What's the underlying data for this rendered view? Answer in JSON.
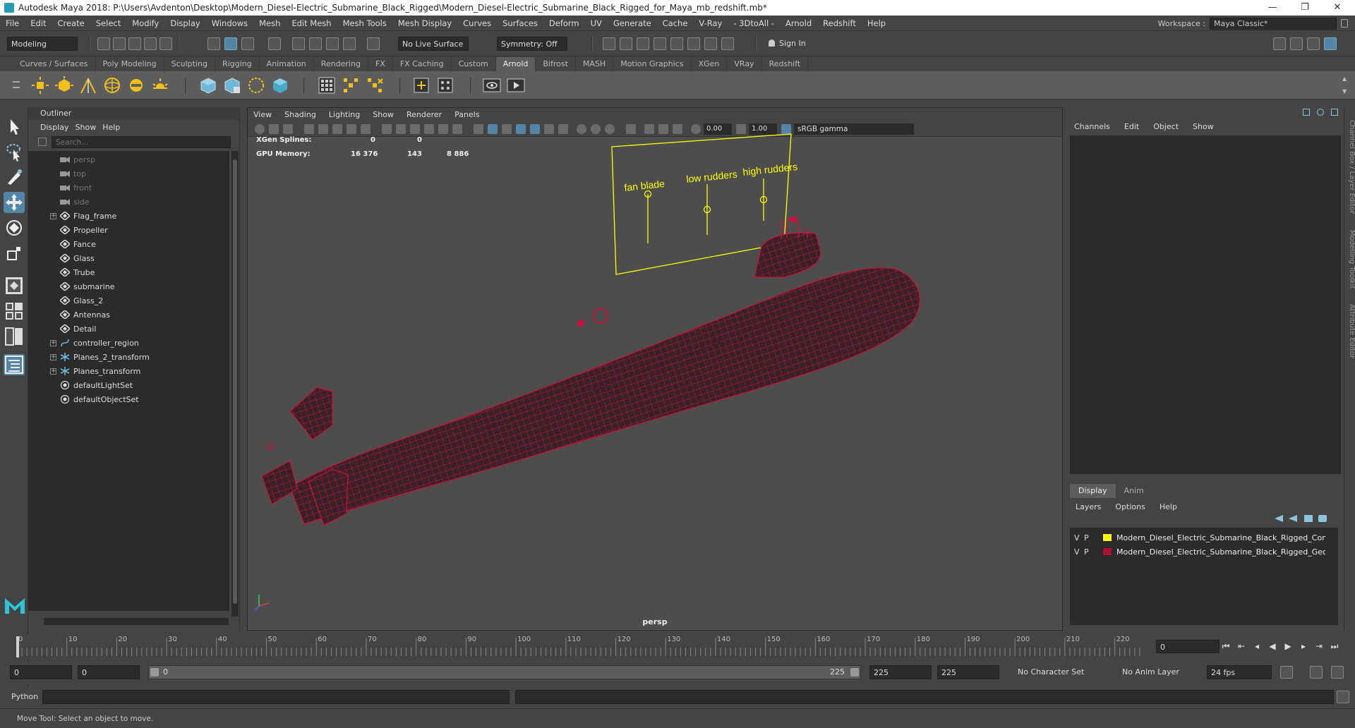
{
  "window": {
    "title": "Autodesk Maya 2018: P:\\Users\\Avdenton\\Desktop\\Modern_Diesel-Electric_Submarine_Black_Rigged\\Modern_Diesel-Electric_Submarine_Black_Rigged_for_Maya_mb_redshift.mb*",
    "minimize": "—",
    "maximize": "❐",
    "close": "✕"
  },
  "menubar": [
    "File",
    "Edit",
    "Create",
    "Select",
    "Modify",
    "Display",
    "Windows",
    "Mesh",
    "Edit Mesh",
    "Mesh Tools",
    "Mesh Display",
    "Curves",
    "Surfaces",
    "Deform",
    "UV",
    "Generate",
    "Cache",
    "V-Ray",
    "- 3DtoAll -",
    "Arnold",
    "Redshift",
    "Help"
  ],
  "workspace": {
    "label": "Workspace :",
    "value": "Maya Classic*"
  },
  "statusline": {
    "mode": "Modeling",
    "live_surface": "No Live Surface",
    "symmetry": "Symmetry: Off",
    "sign_in": "Sign In"
  },
  "shelf_tabs": [
    "Curves / Surfaces",
    "Poly Modeling",
    "Sculpting",
    "Rigging",
    "Animation",
    "Rendering",
    "FX",
    "FX Caching",
    "Custom",
    "Arnold",
    "Bifrost",
    "MASH",
    "Motion Graphics",
    "XGen",
    "VRay",
    "Redshift"
  ],
  "shelf_active": "Arnold",
  "outliner": {
    "title": "Outliner",
    "menu": [
      "Display",
      "Show",
      "Help"
    ],
    "search_placeholder": "Search...",
    "items": [
      {
        "label": "persp",
        "icon": "camera-icon",
        "dim": true,
        "expandable": false
      },
      {
        "label": "top",
        "icon": "camera-icon",
        "dim": true,
        "expandable": false
      },
      {
        "label": "front",
        "icon": "camera-icon",
        "dim": true,
        "expandable": false
      },
      {
        "label": "side",
        "icon": "camera-icon",
        "dim": true,
        "expandable": false
      },
      {
        "label": "Flag_frame",
        "icon": "transform-icon",
        "dim": false,
        "expandable": true
      },
      {
        "label": "Propeller",
        "icon": "transform-icon",
        "dim": false,
        "expandable": false
      },
      {
        "label": "Fance",
        "icon": "transform-icon",
        "dim": false,
        "expandable": false
      },
      {
        "label": "Glass",
        "icon": "transform-icon",
        "dim": false,
        "expandable": false
      },
      {
        "label": "Trube",
        "icon": "transform-icon",
        "dim": false,
        "expandable": false
      },
      {
        "label": "submarine",
        "icon": "transform-icon",
        "dim": false,
        "expandable": false
      },
      {
        "label": "Glass_2",
        "icon": "transform-icon",
        "dim": false,
        "expandable": false
      },
      {
        "label": "Antennas",
        "icon": "transform-icon",
        "dim": false,
        "expandable": false
      },
      {
        "label": "Detail",
        "icon": "transform-icon",
        "dim": false,
        "expandable": false
      },
      {
        "label": "controller_region",
        "icon": "curve-icon",
        "dim": false,
        "expandable": true
      },
      {
        "label": "Planes_2_transform",
        "icon": "joint-icon",
        "dim": false,
        "expandable": true
      },
      {
        "label": "Planes_transform",
        "icon": "joint-icon",
        "dim": false,
        "expandable": true
      },
      {
        "label": "defaultLightSet",
        "icon": "set-icon",
        "dim": false,
        "expandable": false
      },
      {
        "label": "defaultObjectSet",
        "icon": "set-icon",
        "dim": false,
        "expandable": false
      }
    ]
  },
  "viewport": {
    "menu": [
      "View",
      "Shading",
      "Lighting",
      "Show",
      "Renderer",
      "Panels"
    ],
    "exposure": "0.00",
    "gamma": "1.00",
    "colorspace": "sRGB gamma",
    "hud": {
      "xgen_label": "XGen Splines:",
      "xgen_a": "0",
      "xgen_b": "0",
      "gpu_label": "GPU Memory:",
      "gpu_a": "16 376",
      "gpu_b": "143",
      "gpu_c": "8 886"
    },
    "controls": [
      "fan blade",
      "low rudders",
      "high rudders"
    ],
    "camera": "persp",
    "wire_color": "#c8143c",
    "control_color": "#ffff00"
  },
  "channelbox": {
    "menu": [
      "Channels",
      "Edit",
      "Object",
      "Show"
    ],
    "tabs": [
      "Display",
      "Anim"
    ],
    "layer_menu": [
      "Layers",
      "Options",
      "Help"
    ],
    "layers": [
      {
        "v": "V",
        "p": "P",
        "color": "#ffff00",
        "name": "Modern_Diesel_Electric_Submarine_Black_Rigged_Contro"
      },
      {
        "v": "V",
        "p": "P",
        "color": "#b01030",
        "name": "Modern_Diesel_Electric_Submarine_Black_Rigged_Geom"
      }
    ],
    "side_tabs": [
      "Channel Box / Layer Editor",
      "Modelling Toolkit",
      "Attribute Editor"
    ]
  },
  "timeline": {
    "ticks": [
      "0",
      "10",
      "20",
      "30",
      "40",
      "50",
      "60",
      "70",
      "80",
      "90",
      "100",
      "110",
      "120",
      "130",
      "140",
      "150",
      "160",
      "170",
      "180",
      "190",
      "200",
      "210",
      "220"
    ],
    "current_frame": "0",
    "start": "0",
    "range_start": "0",
    "range_slider_start": "0",
    "range_slider_end": "225",
    "end": "225",
    "anim_end": "225",
    "character_set": "No Character Set",
    "anim_layer": "No Anim Layer",
    "fps": "24 fps"
  },
  "cmdline": {
    "label": "Python"
  },
  "helpline": {
    "text": "Move Tool: Select an object to move."
  }
}
